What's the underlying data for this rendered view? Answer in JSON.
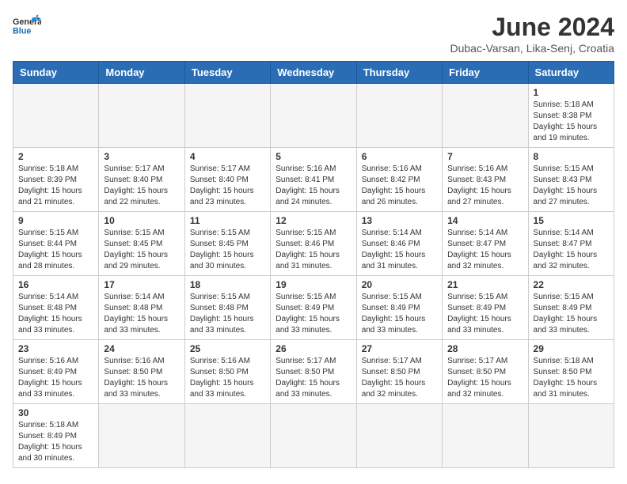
{
  "header": {
    "logo_line1": "General",
    "logo_line2": "Blue",
    "month_year": "June 2024",
    "location": "Dubac-Varsan, Lika-Senj, Croatia"
  },
  "days_of_week": [
    "Sunday",
    "Monday",
    "Tuesday",
    "Wednesday",
    "Thursday",
    "Friday",
    "Saturday"
  ],
  "weeks": [
    [
      {
        "day": "",
        "info": ""
      },
      {
        "day": "",
        "info": ""
      },
      {
        "day": "",
        "info": ""
      },
      {
        "day": "",
        "info": ""
      },
      {
        "day": "",
        "info": ""
      },
      {
        "day": "",
        "info": ""
      },
      {
        "day": "1",
        "info": "Sunrise: 5:18 AM\nSunset: 8:38 PM\nDaylight: 15 hours and 19 minutes."
      }
    ],
    [
      {
        "day": "2",
        "info": "Sunrise: 5:18 AM\nSunset: 8:39 PM\nDaylight: 15 hours and 21 minutes."
      },
      {
        "day": "3",
        "info": "Sunrise: 5:17 AM\nSunset: 8:40 PM\nDaylight: 15 hours and 22 minutes."
      },
      {
        "day": "4",
        "info": "Sunrise: 5:17 AM\nSunset: 8:40 PM\nDaylight: 15 hours and 23 minutes."
      },
      {
        "day": "5",
        "info": "Sunrise: 5:16 AM\nSunset: 8:41 PM\nDaylight: 15 hours and 24 minutes."
      },
      {
        "day": "6",
        "info": "Sunrise: 5:16 AM\nSunset: 8:42 PM\nDaylight: 15 hours and 26 minutes."
      },
      {
        "day": "7",
        "info": "Sunrise: 5:16 AM\nSunset: 8:43 PM\nDaylight: 15 hours and 27 minutes."
      },
      {
        "day": "8",
        "info": "Sunrise: 5:15 AM\nSunset: 8:43 PM\nDaylight: 15 hours and 27 minutes."
      }
    ],
    [
      {
        "day": "9",
        "info": "Sunrise: 5:15 AM\nSunset: 8:44 PM\nDaylight: 15 hours and 28 minutes."
      },
      {
        "day": "10",
        "info": "Sunrise: 5:15 AM\nSunset: 8:45 PM\nDaylight: 15 hours and 29 minutes."
      },
      {
        "day": "11",
        "info": "Sunrise: 5:15 AM\nSunset: 8:45 PM\nDaylight: 15 hours and 30 minutes."
      },
      {
        "day": "12",
        "info": "Sunrise: 5:15 AM\nSunset: 8:46 PM\nDaylight: 15 hours and 31 minutes."
      },
      {
        "day": "13",
        "info": "Sunrise: 5:14 AM\nSunset: 8:46 PM\nDaylight: 15 hours and 31 minutes."
      },
      {
        "day": "14",
        "info": "Sunrise: 5:14 AM\nSunset: 8:47 PM\nDaylight: 15 hours and 32 minutes."
      },
      {
        "day": "15",
        "info": "Sunrise: 5:14 AM\nSunset: 8:47 PM\nDaylight: 15 hours and 32 minutes."
      }
    ],
    [
      {
        "day": "16",
        "info": "Sunrise: 5:14 AM\nSunset: 8:48 PM\nDaylight: 15 hours and 33 minutes."
      },
      {
        "day": "17",
        "info": "Sunrise: 5:14 AM\nSunset: 8:48 PM\nDaylight: 15 hours and 33 minutes."
      },
      {
        "day": "18",
        "info": "Sunrise: 5:15 AM\nSunset: 8:48 PM\nDaylight: 15 hours and 33 minutes."
      },
      {
        "day": "19",
        "info": "Sunrise: 5:15 AM\nSunset: 8:49 PM\nDaylight: 15 hours and 33 minutes."
      },
      {
        "day": "20",
        "info": "Sunrise: 5:15 AM\nSunset: 8:49 PM\nDaylight: 15 hours and 33 minutes."
      },
      {
        "day": "21",
        "info": "Sunrise: 5:15 AM\nSunset: 8:49 PM\nDaylight: 15 hours and 33 minutes."
      },
      {
        "day": "22",
        "info": "Sunrise: 5:15 AM\nSunset: 8:49 PM\nDaylight: 15 hours and 33 minutes."
      }
    ],
    [
      {
        "day": "23",
        "info": "Sunrise: 5:16 AM\nSunset: 8:49 PM\nDaylight: 15 hours and 33 minutes."
      },
      {
        "day": "24",
        "info": "Sunrise: 5:16 AM\nSunset: 8:50 PM\nDaylight: 15 hours and 33 minutes."
      },
      {
        "day": "25",
        "info": "Sunrise: 5:16 AM\nSunset: 8:50 PM\nDaylight: 15 hours and 33 minutes."
      },
      {
        "day": "26",
        "info": "Sunrise: 5:17 AM\nSunset: 8:50 PM\nDaylight: 15 hours and 33 minutes."
      },
      {
        "day": "27",
        "info": "Sunrise: 5:17 AM\nSunset: 8:50 PM\nDaylight: 15 hours and 32 minutes."
      },
      {
        "day": "28",
        "info": "Sunrise: 5:17 AM\nSunset: 8:50 PM\nDaylight: 15 hours and 32 minutes."
      },
      {
        "day": "29",
        "info": "Sunrise: 5:18 AM\nSunset: 8:50 PM\nDaylight: 15 hours and 31 minutes."
      }
    ],
    [
      {
        "day": "30",
        "info": "Sunrise: 5:18 AM\nSunset: 8:49 PM\nDaylight: 15 hours and 30 minutes."
      },
      {
        "day": "",
        "info": ""
      },
      {
        "day": "",
        "info": ""
      },
      {
        "day": "",
        "info": ""
      },
      {
        "day": "",
        "info": ""
      },
      {
        "day": "",
        "info": ""
      },
      {
        "day": "",
        "info": ""
      }
    ]
  ]
}
